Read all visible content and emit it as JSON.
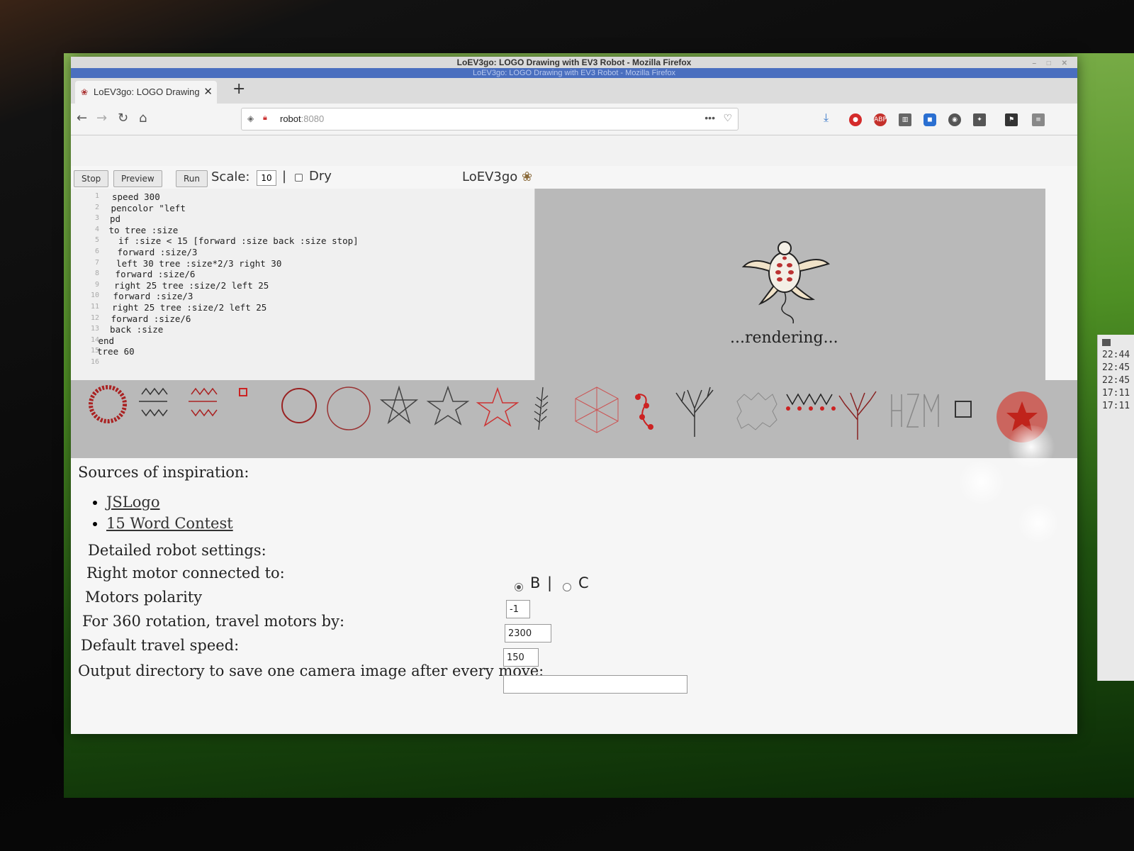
{
  "window": {
    "title": "LoEV3go: LOGO Drawing with EV3 Robot - Mozilla Firefox",
    "title_echo": "LoEV3go: LOGO Drawing with EV3 Robot - Mozilla Firefox"
  },
  "tab": {
    "label": "LoEV3go: LOGO Drawing"
  },
  "url": {
    "host": "robot",
    "port": ":8080"
  },
  "toolbar": {
    "stop_label": "Stop",
    "preview_label": "Preview",
    "run_label": "Run",
    "scale_label": "Scale:",
    "scale_value": "10",
    "separator": "|",
    "dry_label": "Dry",
    "app_title": "LoEV3go"
  },
  "editor": {
    "lines": [
      {
        "n": "1",
        "code": "speed 300"
      },
      {
        "n": "2",
        "code": "pencolor \"left"
      },
      {
        "n": "3",
        "code": "pd"
      },
      {
        "n": "4",
        "code": "to tree :size"
      },
      {
        "n": "5",
        "code": "  if :size < 15 [forward :size back :size stop]"
      },
      {
        "n": "6",
        "code": "  forward :size/3"
      },
      {
        "n": "7",
        "code": "  left 30 tree :size*2/3 right 30"
      },
      {
        "n": "8",
        "code": "  forward :size/6"
      },
      {
        "n": "9",
        "code": "  right 25 tree :size/2 left 25"
      },
      {
        "n": "10",
        "code": "  forward :size/3"
      },
      {
        "n": "11",
        "code": "  right 25 tree :size/2 left 25"
      },
      {
        "n": "12",
        "code": "  forward :size/6"
      },
      {
        "n": "13",
        "code": "  back :size"
      },
      {
        "n": "14",
        "code": "end"
      },
      {
        "n": "15",
        "code": "tree 60"
      },
      {
        "n": "16",
        "code": ""
      }
    ]
  },
  "preview": {
    "status": "...rendering..."
  },
  "sources": {
    "heading": "Sources of inspiration:",
    "links": [
      "JSLogo",
      "15 Word Contest"
    ]
  },
  "settings": {
    "heading": "Detailed robot settings:",
    "right_motor_label": "Right motor connected to:",
    "right_motor_options": [
      "B",
      "C"
    ],
    "right_motor_selected": "B",
    "radio_separator": "|",
    "polarity_label": "Motors polarity",
    "polarity_value": "-1",
    "rotation_label": "For 360 rotation, travel motors by:",
    "rotation_value": "2300",
    "speed_label": "Default travel speed:",
    "speed_value": "150",
    "output_label": "Output directory to save one camera image after every move:",
    "output_value": ""
  },
  "side_terminal": {
    "times": [
      "22:44",
      "22:45",
      "22:45",
      "17:11",
      "17:11"
    ]
  },
  "colors": {
    "accent_red": "#d0281e",
    "titlebar_blue": "#4a6fbf",
    "gallery_bg": "#b9b9b9"
  }
}
